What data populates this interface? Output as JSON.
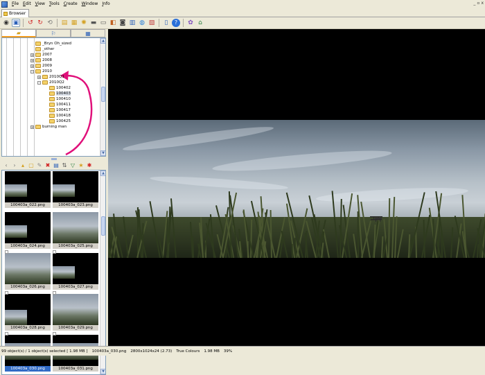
{
  "menu": [
    {
      "key": "F",
      "rest": "ile"
    },
    {
      "key": "E",
      "rest": "dit"
    },
    {
      "key": "V",
      "rest": "iew"
    },
    {
      "key": "T",
      "rest": "ools"
    },
    {
      "key": "C",
      "rest": "reate"
    },
    {
      "key": "W",
      "rest": "indow"
    },
    {
      "key": "I",
      "rest": "nfo"
    }
  ],
  "window_controls": [
    "_",
    "▫",
    "x"
  ],
  "tab": {
    "label": "Browser"
  },
  "tree": {
    "items": [
      {
        "label": "_Bryn Oh_sized",
        "level": 3,
        "expander": ""
      },
      {
        "label": "_other",
        "level": 3,
        "expander": ""
      },
      {
        "label": "2007",
        "level": 3,
        "expander": "+"
      },
      {
        "label": "2008",
        "level": 3,
        "expander": "+"
      },
      {
        "label": "2009",
        "level": 3,
        "expander": "+"
      },
      {
        "label": "2010",
        "level": 3,
        "expander": "-"
      },
      {
        "label": "2010Q1",
        "level": 4,
        "expander": "+"
      },
      {
        "label": "2010Q2",
        "level": 4,
        "expander": "-"
      },
      {
        "label": "100402",
        "level": 5,
        "expander": ""
      },
      {
        "label": "100403",
        "level": 5,
        "expander": "",
        "selected": true
      },
      {
        "label": "100410",
        "level": 5,
        "expander": ""
      },
      {
        "label": "100411",
        "level": 5,
        "expander": ""
      },
      {
        "label": "100417",
        "level": 5,
        "expander": ""
      },
      {
        "label": "100418",
        "level": 5,
        "expander": ""
      },
      {
        "label": "100425",
        "level": 5,
        "expander": ""
      },
      {
        "label": "burning man",
        "level": 3,
        "expander": "+"
      }
    ]
  },
  "thumbnails": [
    {
      "name": "100403a_022.png",
      "kind": "small-left"
    },
    {
      "name": "100403a_023.png",
      "kind": "small-left"
    },
    {
      "name": "100403a_024.png",
      "kind": "small-left"
    },
    {
      "name": "100403a_025.png",
      "kind": "full"
    },
    {
      "name": "100403a_026.png",
      "kind": "full"
    },
    {
      "name": "100403a_027.png",
      "kind": "small-left"
    },
    {
      "name": "100403a_028.png",
      "kind": "small-top"
    },
    {
      "name": "100403a_029.png",
      "kind": "full"
    },
    {
      "name": "100403a_030.png",
      "kind": "wide",
      "selected": true
    },
    {
      "name": "100403a_031.png",
      "kind": "wide"
    }
  ],
  "status": {
    "objects": "99 object(s) / 1 object(s) selected  [ 1.98 MB ]",
    "file": "100403a_030.png",
    "dims": "2800x1024x24 (2.73)",
    "colours": "True Colours",
    "size": "1.98 MB",
    "zoom": "39%"
  },
  "colors": {
    "accent_pink": "#e0107a",
    "selection_blue": "#316ac5"
  }
}
